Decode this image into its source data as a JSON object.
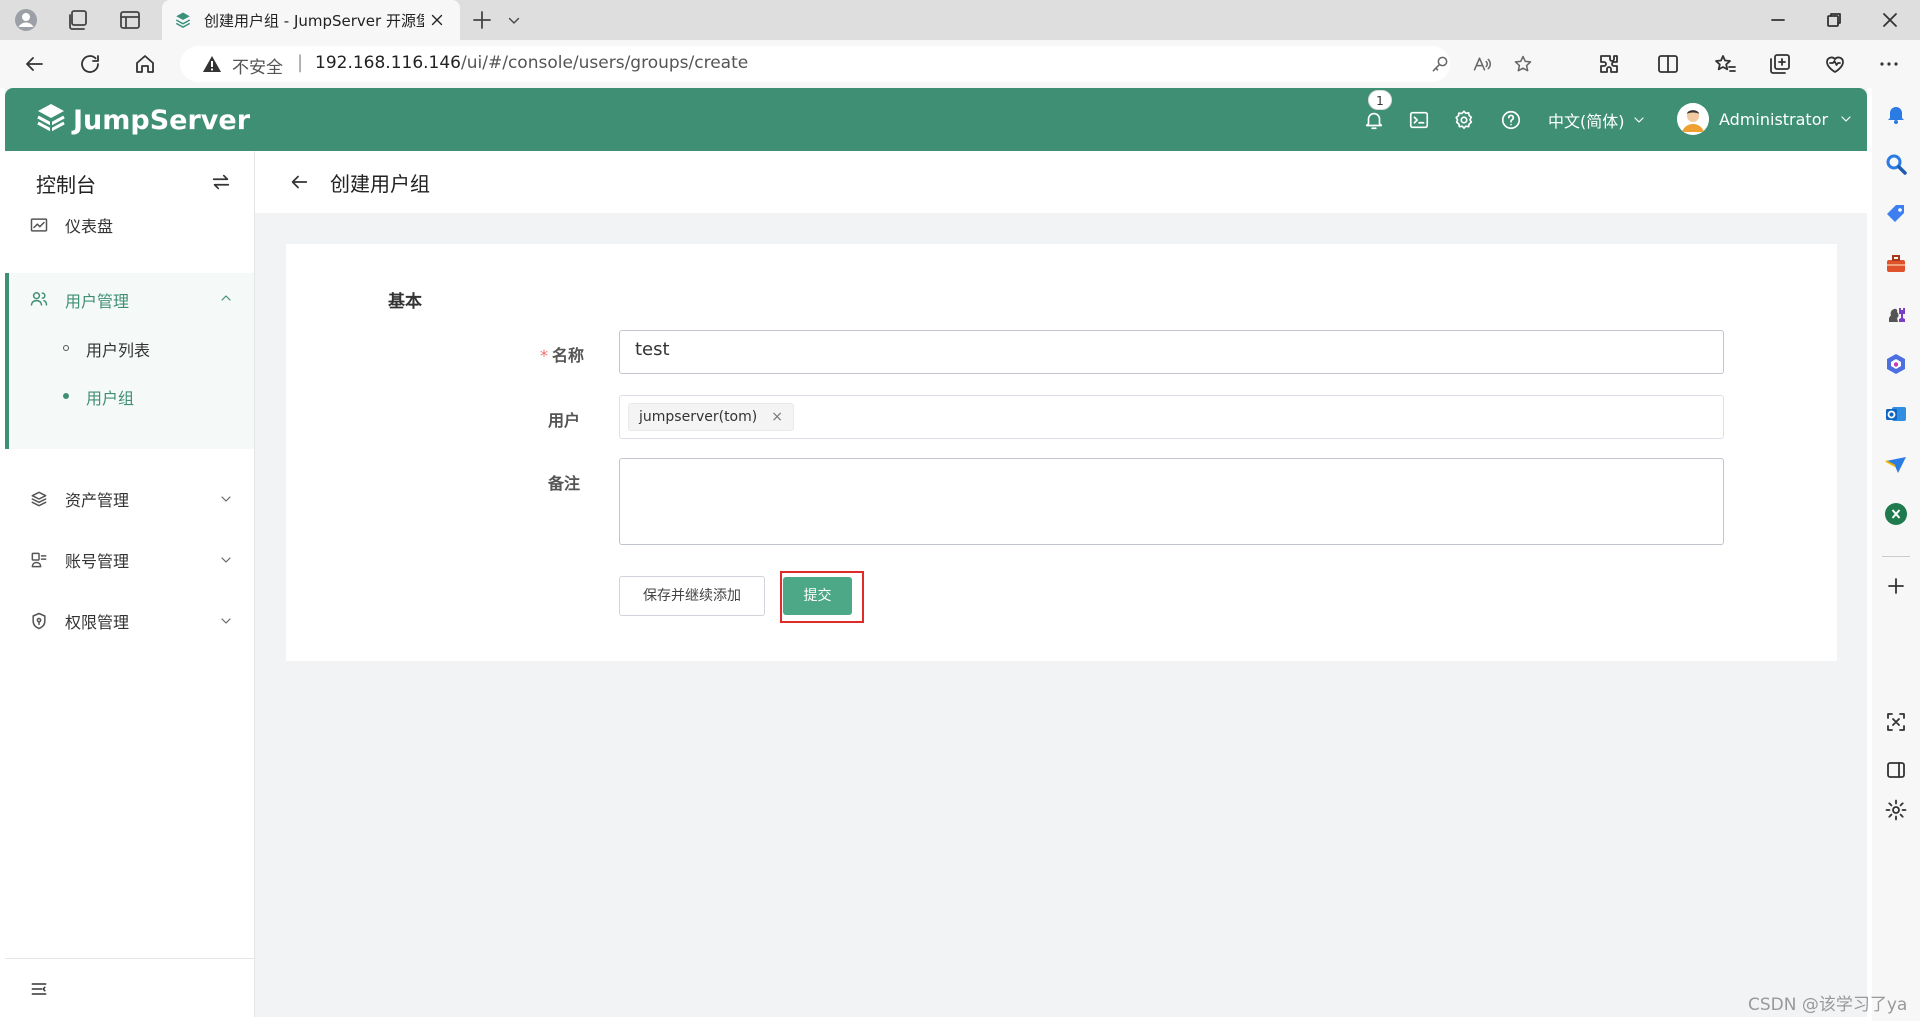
{
  "browser": {
    "tab_title": "创建用户组 - JumpServer 开源堡",
    "security_label": "不安全",
    "url_host": "192.168.116.146",
    "url_path": "/ui/#/console/users/groups/create"
  },
  "header": {
    "brand": "JumpServer",
    "notification_count": "1",
    "language": "中文(简体)",
    "username": "Administrator",
    "brand_color": "#3f8f74"
  },
  "sidebar": {
    "title": "控制台",
    "items": [
      {
        "label": "仪表盘",
        "icon": "dashboard-icon"
      },
      {
        "label": "用户管理",
        "icon": "users-icon",
        "expanded": true,
        "children": [
          {
            "label": "用户列表"
          },
          {
            "label": "用户组",
            "active": true
          }
        ]
      },
      {
        "label": "资产管理",
        "icon": "assets-icon"
      },
      {
        "label": "账号管理",
        "icon": "accounts-icon"
      },
      {
        "label": "权限管理",
        "icon": "permissions-icon"
      }
    ]
  },
  "page": {
    "title": "创建用户组",
    "section": "基本",
    "fields": {
      "name_label": "名称",
      "name_required_mark": "*",
      "name_value": "test",
      "users_label": "用户",
      "users_selected": [
        "jumpserver(tom)"
      ],
      "remark_label": "备注",
      "remark_value": ""
    },
    "buttons": {
      "save_continue": "保存并继续添加",
      "submit": "提交"
    }
  },
  "watermark": "CSDN @该学习了ya"
}
